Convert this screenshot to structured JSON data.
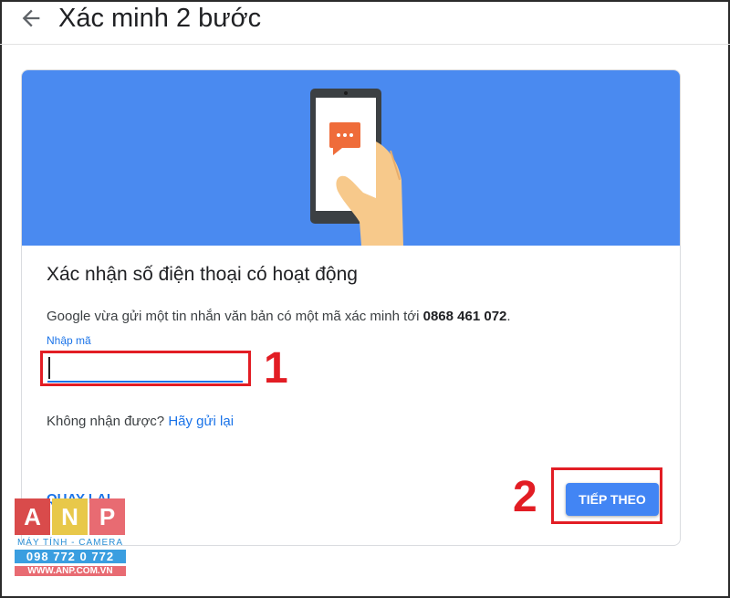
{
  "page": {
    "title": "Xác minh 2 bước"
  },
  "card": {
    "heading": "Xác nhận số điện thoại có hoạt động",
    "description_prefix": "Google vừa gửi một tin nhắn văn bản có một mã xác minh tới ",
    "phone_number": "0868 461 072",
    "description_suffix": ".",
    "input_label": "Nhập mã",
    "input_value": "",
    "resend_prefix": "Không nhận được? ",
    "resend_link": "Hãy gửi lại",
    "back_label": "QUAY LẠI",
    "next_label": "TIẾP THEO"
  },
  "annotations": {
    "step1": "1",
    "step2": "2"
  },
  "watermark": {
    "letters": [
      "A",
      "N",
      "P"
    ],
    "subtitle": "MÁY TÍNH - CAMERA",
    "phone": "098 772 0 772",
    "website": "WWW.ANP.COM.VN"
  },
  "colors": {
    "banner": "#4a8af0",
    "accent": "#1a73e8",
    "primary_button": "#4285f4",
    "highlight": "#e21d24"
  },
  "icons": {
    "back": "arrow-left-icon",
    "illustration": "phone-message-illustration"
  }
}
